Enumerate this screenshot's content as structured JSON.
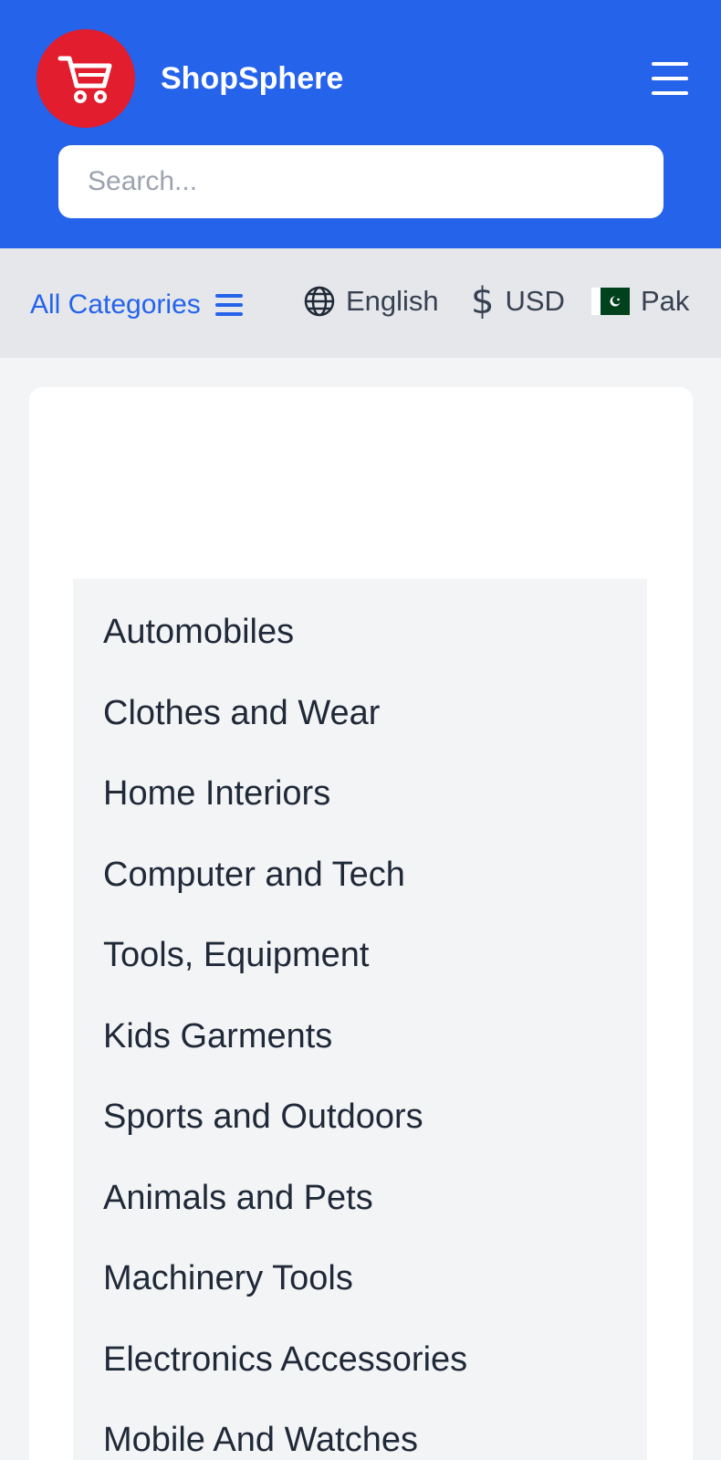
{
  "header": {
    "brand": "ShopSphere",
    "logo_icon": "shopping-cart-icon",
    "menu_icon": "hamburger-menu-icon",
    "search_placeholder": "Search...",
    "colors": {
      "header_bg": "#2563eb",
      "logo_bg": "#e11d2e"
    }
  },
  "topbar": {
    "all_categories_label": "All Categories",
    "language": {
      "icon": "globe-icon",
      "label": "English"
    },
    "currency": {
      "icon": "dollar-icon",
      "label": "USD"
    },
    "country": {
      "icon": "pakistan-flag-icon",
      "label": "Pak"
    }
  },
  "categories": [
    "Automobiles",
    "Clothes and Wear",
    "Home Interiors",
    "Computer and Tech",
    "Tools, Equipment",
    "Kids Garments",
    "Sports and Outdoors",
    "Animals and Pets",
    "Machinery Tools",
    "Electronics Accessories",
    "Mobile And Watches"
  ]
}
